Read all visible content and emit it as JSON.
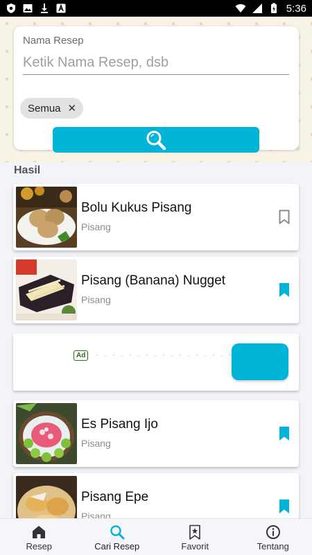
{
  "status_bar": {
    "time": "5:36"
  },
  "search": {
    "field_label": "Nama Resep",
    "placeholder": "Ketik Nama Resep, dsb",
    "value": "",
    "chip_label": "Semua",
    "chip_close": "✕"
  },
  "results": {
    "heading": "Hasil",
    "items": [
      {
        "title": "Bolu Kukus Pisang",
        "category": "Pisang",
        "bookmarked": false
      },
      {
        "title": "Pisang (Banana) Nugget",
        "category": "Pisang",
        "bookmarked": true
      },
      {
        "title": "Es Pisang Ijo",
        "category": "Pisang",
        "bookmarked": true
      },
      {
        "title": "Pisang Epe",
        "category": "Pisang",
        "bookmarked": true
      }
    ]
  },
  "ad": {
    "badge": "Ad"
  },
  "bottom_nav": {
    "items": [
      {
        "label": "Resep",
        "icon": "home-icon"
      },
      {
        "label": "Cari Resep",
        "icon": "search-icon",
        "active": true
      },
      {
        "label": "Favorit",
        "icon": "bookmark-star-icon"
      },
      {
        "label": "Tentang",
        "icon": "info-icon"
      }
    ]
  },
  "colors": {
    "accent": "#00b4d8",
    "bookmark_outline": "#8a8a8a"
  }
}
